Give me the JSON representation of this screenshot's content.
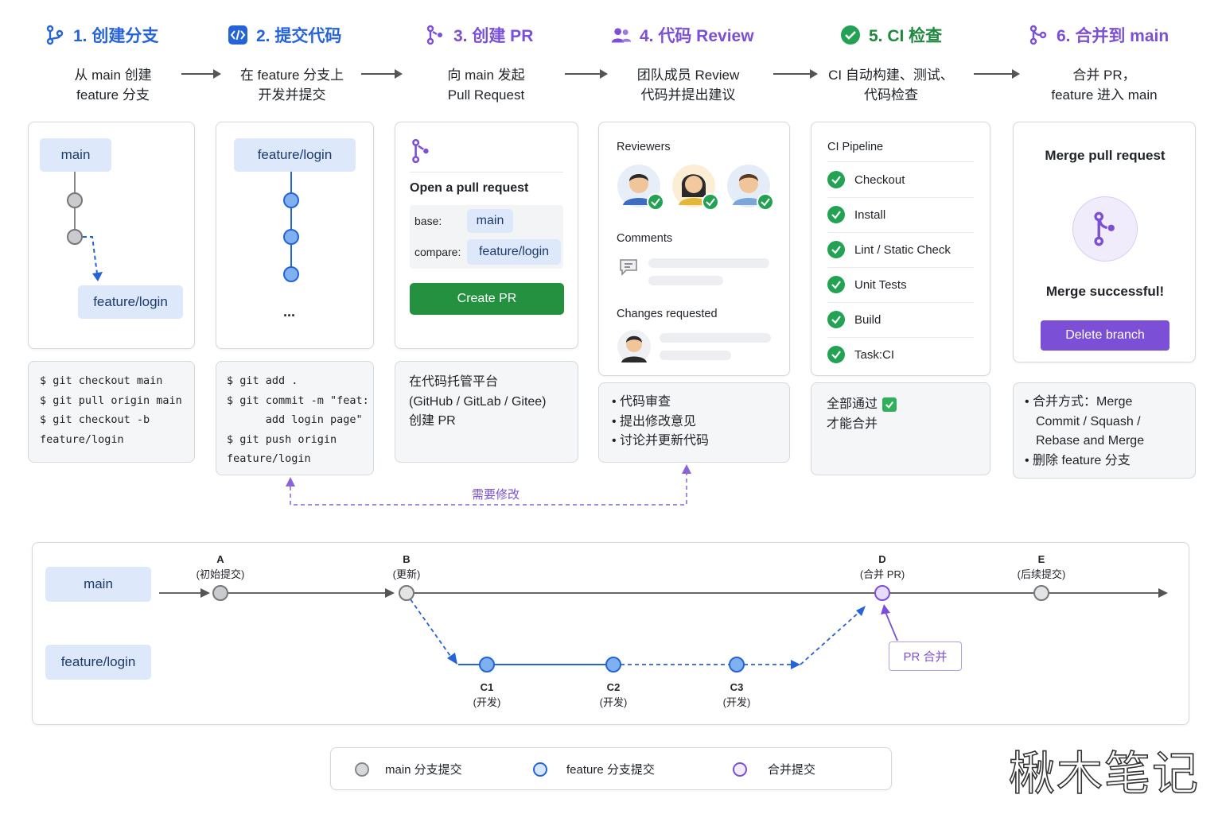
{
  "colors": {
    "blue": "#2563d8",
    "purple": "#7b4fd6",
    "green": "#23a254",
    "pill_bg": "#dde9fb",
    "main_commit": "#c9cbcf",
    "feature_commit": "#7fb0f0",
    "merge_commit": "#e6dcfb"
  },
  "steps": [
    {
      "title": "1. 创建分支",
      "icon": "branch-icon",
      "desc1": "从 main 创建",
      "desc2": "feature 分支"
    },
    {
      "title": "2. 提交代码",
      "icon": "code-icon",
      "desc1": "在 feature 分支上",
      "desc2": "开发并提交"
    },
    {
      "title": "3. 创建 PR",
      "icon": "pull-request-icon",
      "desc1": "向 main 发起",
      "desc2": "Pull Request"
    },
    {
      "title": "4. 代码 Review",
      "icon": "users-icon",
      "desc1": "团队成员 Review",
      "desc2": "代码并提出建议"
    },
    {
      "title": "5. CI 检查",
      "icon": "check-circle-icon",
      "desc1": "CI 自动构建、测试、",
      "desc2": "代码检查"
    },
    {
      "title": "6. 合并到 main",
      "icon": "merge-icon",
      "desc1": "合并 PR，",
      "desc2": "feature 进入 main"
    }
  ],
  "card1": {
    "main": "main",
    "feature": "feature/login",
    "code": [
      "$ git checkout main",
      "$ git pull origin main",
      "$ git checkout -b",
      "feature/login"
    ]
  },
  "card2": {
    "feature": "feature/login",
    "more": "...",
    "code": [
      "$ git add .",
      "$ git commit -m \"feat:",
      "      add login page\"",
      "$ git push origin",
      "feature/login"
    ]
  },
  "card3": {
    "heading": "Open a pull request",
    "base_label": "base:",
    "base_value": "main",
    "compare_label": "compare:",
    "compare_value": "feature/login",
    "button": "Create PR",
    "note": [
      "在代码托管平台",
      "(GitHub / GitLab / Gitee)",
      "创建 PR"
    ]
  },
  "card4": {
    "reviewers": "Reviewers",
    "comments": "Comments",
    "changes": "Changes requested",
    "bullets": [
      "代码审查",
      "提出修改意见",
      "讨论并更新代码"
    ]
  },
  "card5": {
    "heading": "CI Pipeline",
    "items": [
      "Checkout",
      "Install",
      "Lint / Static Check",
      "Unit Tests",
      "Build",
      "Task:CI"
    ],
    "note1": "全部通过",
    "note2": "才能合并"
  },
  "card6": {
    "heading": "Merge pull request",
    "success": "Merge successful!",
    "button": "Delete branch",
    "bullets": [
      "合并方式：Merge",
      "Commit / Squash /",
      "Rebase and Merge",
      "删除 feature 分支"
    ]
  },
  "loop_label": "需要修改",
  "timeline": {
    "main_label": "main",
    "feature_label": "feature/login",
    "commits": [
      {
        "id": "A",
        "note": "(初始提交)"
      },
      {
        "id": "B",
        "note": "(更新)"
      },
      {
        "id": "C1",
        "note": "(开发)"
      },
      {
        "id": "C2",
        "note": "(开发)"
      },
      {
        "id": "C3",
        "note": "(开发)"
      },
      {
        "id": "D",
        "note": "(合并 PR)"
      },
      {
        "id": "E",
        "note": "(后续提交)"
      }
    ],
    "pr_merge": "PR 合并"
  },
  "legend": [
    {
      "label": "main 分支提交"
    },
    {
      "label": "feature 分支提交"
    },
    {
      "label": "合并提交"
    }
  ],
  "watermark": "楸木笔记"
}
